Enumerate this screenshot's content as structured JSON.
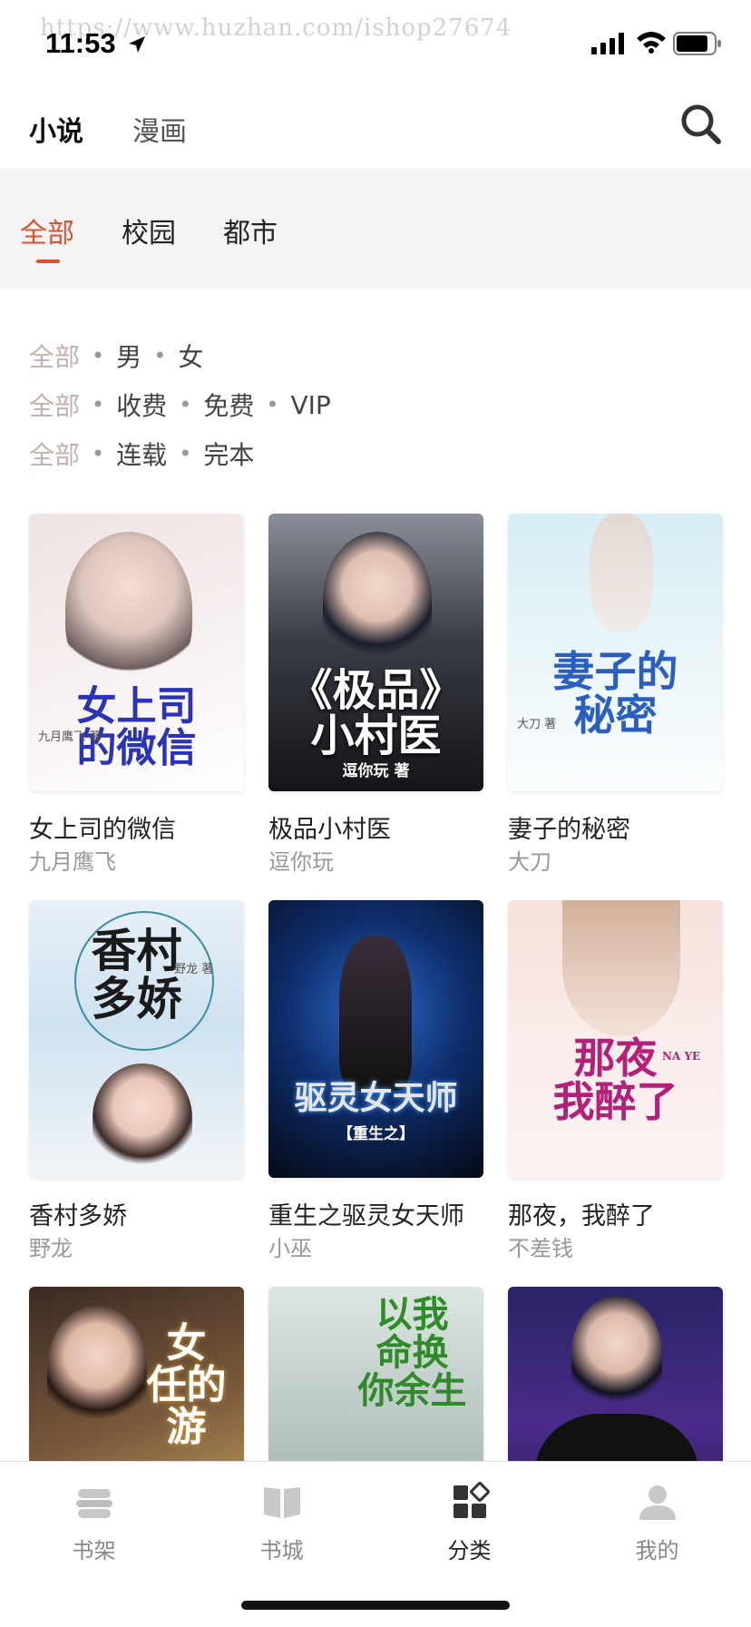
{
  "status_bar": {
    "watermark": "https://www.huzhan.com/ishop27674",
    "time": "11:53"
  },
  "top_nav": {
    "tabs": [
      {
        "label": "小说"
      },
      {
        "label": "漫画"
      }
    ],
    "search_icon": "search-icon"
  },
  "category_tabs": [
    {
      "label": "全部"
    },
    {
      "label": "校园"
    },
    {
      "label": "都市"
    }
  ],
  "accent_color": "#e0502e",
  "filters": [
    [
      "全部",
      "男",
      "女"
    ],
    [
      "全部",
      "收费",
      "免费",
      "VIP"
    ],
    [
      "全部",
      "连载",
      "完本"
    ]
  ],
  "books": [
    {
      "title": "女上司的微信",
      "author": "九月鹰飞",
      "cover_text": "女上司\n的微信",
      "cover_small": "九月鹰飞 著"
    },
    {
      "title": "极品小村医",
      "author": "逗你玩",
      "cover_text": "《极品》\n小村医",
      "cover_small": "逗你玩 著"
    },
    {
      "title": "妻子的秘密",
      "author": "大刀",
      "cover_text": "妻子的\n秘密",
      "cover_small": "大刀 著"
    },
    {
      "title": "香村多娇",
      "author": "野龙",
      "cover_text": "香村\n多娇",
      "cover_small": "野龙 著"
    },
    {
      "title": "重生之驱灵女天师",
      "author": "小巫",
      "cover_text": "驱灵女天师",
      "cover_small": "【重生之】"
    },
    {
      "title": "那夜，我醉了",
      "author": "不差钱",
      "cover_text": "那夜\n我醉了",
      "cover_small": "NA YE"
    },
    {
      "title": "",
      "author": "",
      "cover_text": "女\n任的\n游",
      "cover_small": ""
    },
    {
      "title": "",
      "author": "",
      "cover_text": "以我\n命换\n你余生",
      "cover_small": ""
    },
    {
      "title": "",
      "author": "",
      "cover_text": "",
      "cover_small": ""
    }
  ],
  "bottom_nav": [
    {
      "label": "书架",
      "icon": "bookshelf-icon"
    },
    {
      "label": "书城",
      "icon": "book-icon"
    },
    {
      "label": "分类",
      "icon": "category-icon"
    },
    {
      "label": "我的",
      "icon": "user-icon"
    }
  ]
}
